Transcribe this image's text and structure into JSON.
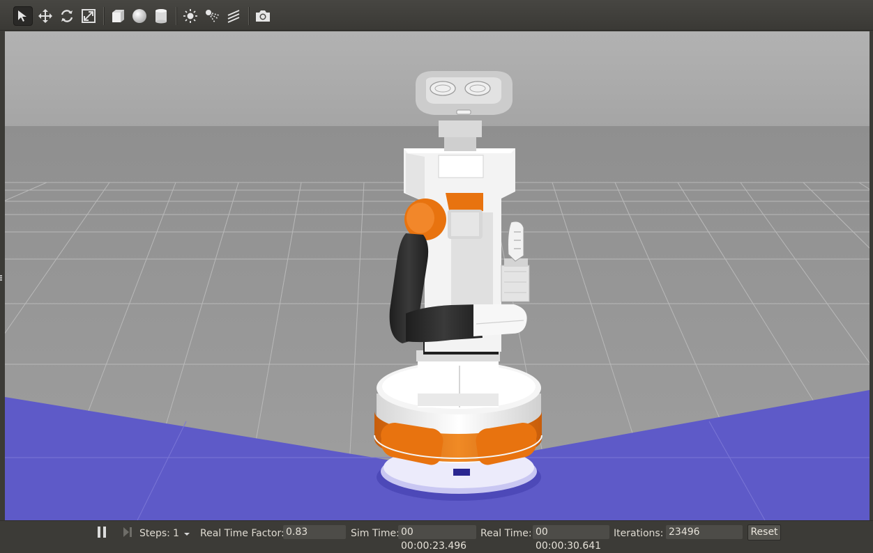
{
  "toolbar": {
    "tools": [
      {
        "icon": "select-arrow-icon",
        "active": true
      },
      {
        "icon": "translate-icon"
      },
      {
        "icon": "rotate-icon"
      },
      {
        "icon": "scale-icon"
      },
      {
        "icon": "box-shape-icon"
      },
      {
        "icon": "sphere-shape-icon"
      },
      {
        "icon": "cylinder-shape-icon"
      },
      {
        "icon": "point-light-icon"
      },
      {
        "icon": "spot-light-icon"
      },
      {
        "icon": "directional-light-icon"
      },
      {
        "icon": "screenshot-camera-icon"
      }
    ]
  },
  "colors": {
    "sky": "#a8a8a8",
    "ground": "#999999",
    "grid_line": "#bdbdbd",
    "plane_blue": "#5e5ac8",
    "robot_orange": "#e8730f",
    "robot_white": "#f2f2f2",
    "robot_black": "#2a2a2a"
  },
  "status": {
    "steps_label": "Steps:",
    "steps_value": "1",
    "rtf_label": "Real Time Factor:",
    "rtf_value": "0.83",
    "sim_time_label": "Sim Time:",
    "sim_time_value": "00 00:00:23.496",
    "real_time_label": "Real Time:",
    "real_time_value": "00 00:00:30.641",
    "iterations_label": "Iterations:",
    "iterations_value": "23496",
    "reset_label": "Reset"
  }
}
